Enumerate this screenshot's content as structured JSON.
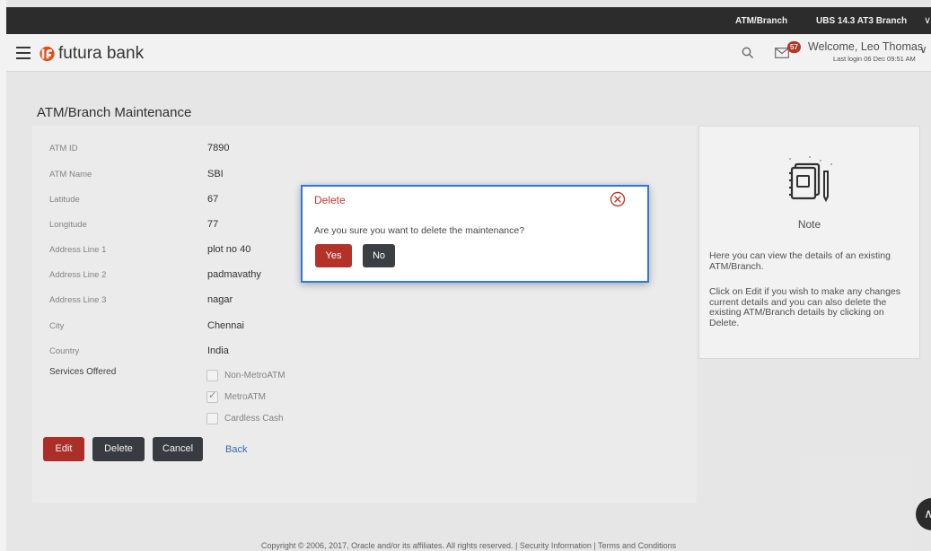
{
  "topbar": {
    "entity": "ATM/Branch",
    "branch": "UBS 14.3 AT3 Branch",
    "chevron": "∨"
  },
  "header": {
    "brand": "futura bank",
    "icons": {
      "menu": "hamburger-icon",
      "search": "search-icon",
      "mail": "mail-icon"
    },
    "notification_count": "57",
    "welcome": "Welcome, Leo Thomas",
    "last_login": "Last login 06 Dec 09:51 AM",
    "user_chevron": "∨"
  },
  "page": {
    "title": "ATM/Branch Maintenance"
  },
  "details": [
    {
      "label": "ATM ID",
      "value": "7890"
    },
    {
      "label": "ATM Name",
      "value": "SBI"
    },
    {
      "label": "Latitude",
      "value": "67"
    },
    {
      "label": "Longitude",
      "value": "77"
    },
    {
      "label": "Address Line 1",
      "value": "plot no 40"
    },
    {
      "label": "Address Line 2",
      "value": "padmavathy"
    },
    {
      "label": "Address Line 3",
      "value": "nagar"
    },
    {
      "label": "City",
      "value": "Chennai"
    },
    {
      "label": "Country",
      "value": "India"
    }
  ],
  "services": {
    "label": "Services Offered",
    "options": [
      {
        "label": "Non-MetroATM",
        "checked": false
      },
      {
        "label": "MetroATM",
        "checked": true
      },
      {
        "label": "Cardless Cash",
        "checked": false
      }
    ]
  },
  "actions": {
    "edit": "Edit",
    "delete": "Delete",
    "cancel": "Cancel",
    "back": "Back"
  },
  "note": {
    "title": "Note",
    "p1": "Here you can view the details of an existing ATM/Branch.",
    "p2": "Click on Edit if you wish to make any changes current details and you can also delete the existing ATM/Branch details by clicking on Delete."
  },
  "dialog": {
    "title": "Delete",
    "message": "Are you sure you want to delete the maintenance?",
    "yes": "Yes",
    "no": "No"
  },
  "footer": {
    "text": "Copyright © 2006, 2017, Oracle and/or its affiliates. All rights reserved. | Security Information | Terms and Conditions"
  },
  "colors": {
    "accent_red": "#b5322b",
    "dark_button": "#3b3f44",
    "link_blue": "#3c6fb3",
    "dialog_border": "#2b78e4"
  }
}
